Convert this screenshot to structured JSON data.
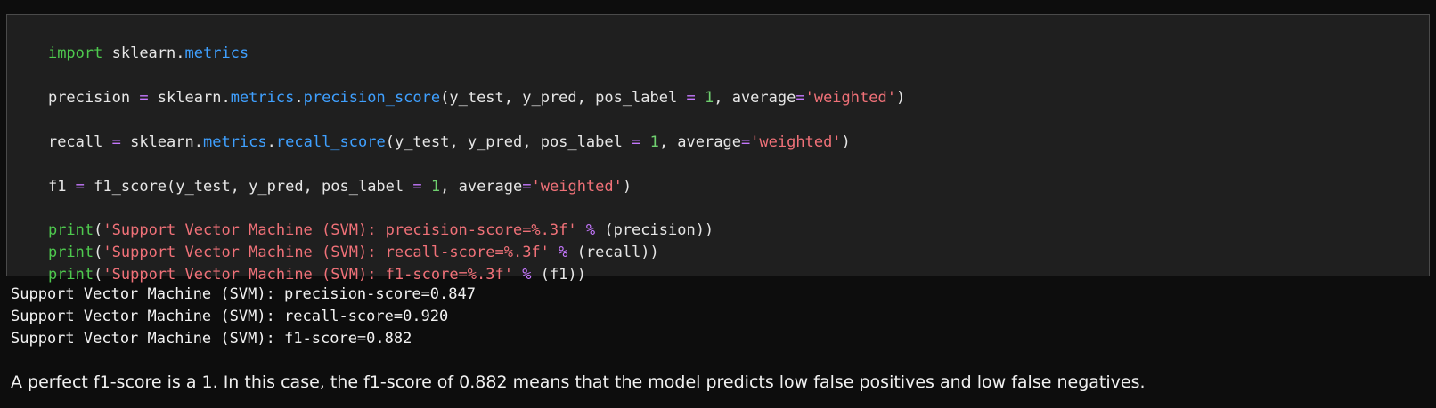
{
  "code": {
    "line1": [
      "import",
      " sklearn.",
      "metrics"
    ],
    "line2": [
      "precision",
      " = ",
      "sklearn.",
      "metrics",
      ".",
      "precision_score",
      "(y_test, y_pred, pos_label ",
      "=",
      " ",
      "1",
      ", average",
      "=",
      "'weighted'",
      ")"
    ],
    "line3": [
      "recall",
      " = ",
      "sklearn.",
      "metrics",
      ".",
      "recall_score",
      "(y_test, y_pred, pos_label ",
      "=",
      " ",
      "1",
      ", average",
      "=",
      "'weighted'",
      ")"
    ],
    "line4": [
      "f1",
      " = ",
      "f1_score(y_test, y_pred, pos_label ",
      "=",
      " ",
      "1",
      ", average",
      "=",
      "'weighted'",
      ")"
    ],
    "line5": [
      "print",
      "(",
      "'Support Vector Machine (SVM): precision-score=%.3f'",
      " ",
      "%",
      " (precision))"
    ],
    "line6": [
      "print",
      "(",
      "'Support Vector Machine (SVM): recall-score=%.3f'",
      " ",
      "%",
      " (recall))"
    ],
    "line7": [
      "print",
      "(",
      "'Support Vector Machine (SVM): f1-score=%.3f'",
      " ",
      "%",
      " (f1))"
    ]
  },
  "output": [
    "Support Vector Machine (SVM): precision-score=0.847",
    "Support Vector Machine (SVM): recall-score=0.920",
    "Support Vector Machine (SVM): f1-score=0.882"
  ],
  "markdown_text": "A perfect f1-score is a 1. In this case, the f1-score of 0.882 means that the model predicts low false positives and low false negatives.",
  "colors": {
    "background": "#0d0d0d",
    "cell_background": "#1f1f1f",
    "keyword": "#4ec94e",
    "attribute": "#3fa0ff",
    "operator": "#c678ff",
    "string": "#f07178",
    "number": "#6fd06f"
  }
}
